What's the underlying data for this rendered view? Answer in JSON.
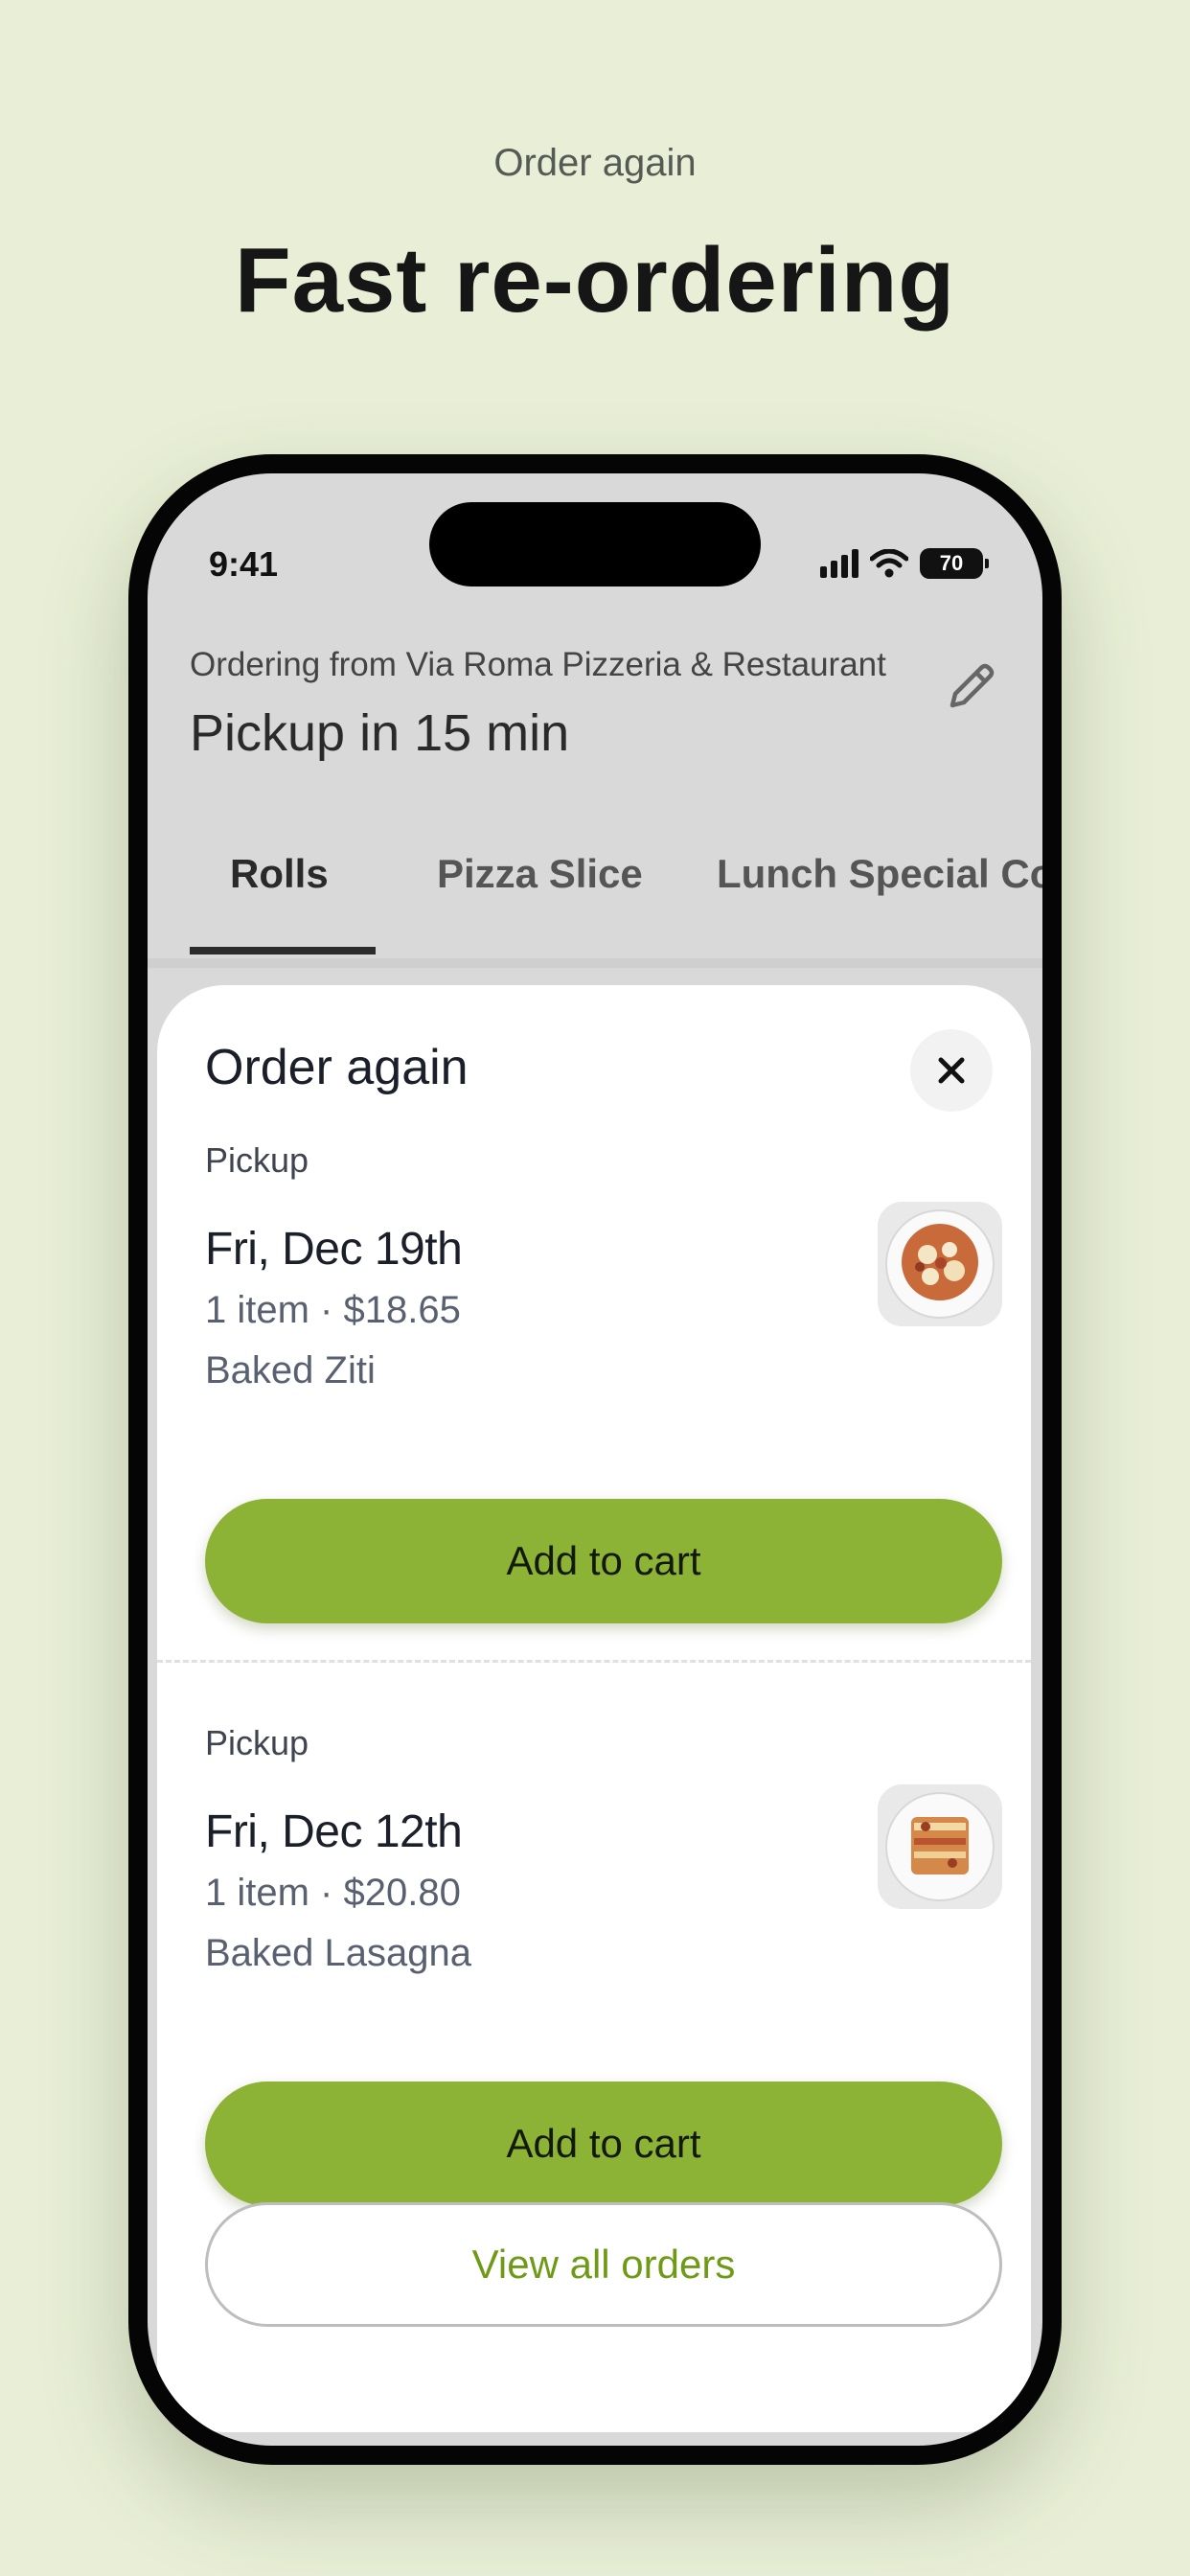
{
  "hero": {
    "eyebrow": "Order again",
    "title": "Fast re-ordering"
  },
  "status_bar": {
    "time": "9:41",
    "battery": "70"
  },
  "header": {
    "ordering_from": "Ordering from Via Roma Pizzeria & Restaurant",
    "pickup_time": "Pickup in 15 min"
  },
  "tabs": [
    {
      "label": "Rolls",
      "active": true
    },
    {
      "label": "Pizza Slice",
      "active": false
    },
    {
      "label": "Lunch Special Combo",
      "active": false
    }
  ],
  "sheet": {
    "title": "Order again",
    "orders": [
      {
        "mode": "Pickup",
        "date": "Fri, Dec 19th",
        "summary": "1 item · $18.65",
        "item": "Baked Ziti",
        "thumbnail": "baked-ziti-photo",
        "button": "Add to cart"
      },
      {
        "mode": "Pickup",
        "date": "Fri, Dec 12th",
        "summary": "1 item · $20.80",
        "item": "Baked Lasagna",
        "thumbnail": "baked-lasagna-photo",
        "button": "Add to cart"
      }
    ],
    "view_all": "View all orders"
  },
  "colors": {
    "background": "#e8efd6",
    "accent": "#8cb236",
    "link": "#6e9a16"
  }
}
